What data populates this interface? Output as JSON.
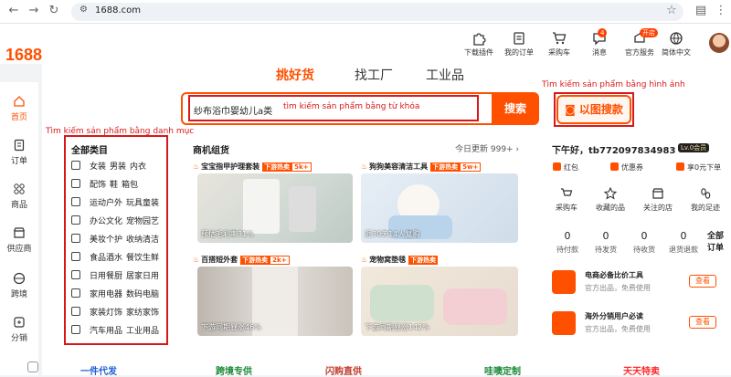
{
  "browser": {
    "url": "1688.com"
  },
  "logo": "1688",
  "topnav": [
    {
      "label": "下载插件"
    },
    {
      "label": "我的订单"
    },
    {
      "label": "采购车"
    },
    {
      "label": "消息",
      "badge": "4"
    },
    {
      "label": "官方服务",
      "badge": "开店"
    },
    {
      "label": "简体中文"
    }
  ],
  "sidebar": [
    {
      "label": "首页"
    },
    {
      "label": "订单"
    },
    {
      "label": "商品"
    },
    {
      "label": "供应商"
    },
    {
      "label": "跨境"
    },
    {
      "label": "分销"
    }
  ],
  "tabs": [
    {
      "label": "挑好货"
    },
    {
      "label": "找工厂"
    },
    {
      "label": "工业品"
    }
  ],
  "search": {
    "value": "纱布浴巾婴幼儿a类",
    "button": "搜索"
  },
  "image_search": {
    "label": "以图搜款"
  },
  "annotations": {
    "keyword": "tìm kiếm sản phẩm bằng từ khóa",
    "image": "Tìm kiếm sản phẩm bằng hình ảnh",
    "category": "Tìm kiếm sản phẩm bằng danh mục"
  },
  "categories": {
    "title": "全部类目",
    "rows": [
      [
        "女装",
        "男装",
        "内衣"
      ],
      [
        "配饰",
        "鞋",
        "箱包"
      ],
      [
        "运动户外",
        "玩具童装"
      ],
      [
        "办公文化",
        "宠物园艺"
      ],
      [
        "美妆个护",
        "收纳清洁"
      ],
      [
        "食品酒水",
        "餐饮生鲜"
      ],
      [
        "日用餐厨",
        "居家日用"
      ],
      [
        "家用电器",
        "数码电脑"
      ],
      [
        "家装灯饰",
        "家纺家饰"
      ],
      [
        "汽车用品",
        "工业用品"
      ]
    ]
  },
  "opportunity": {
    "title": "商机组货",
    "update": "今日更新 999+ ›",
    "hot": "下游热卖",
    "cards": [
      {
        "title": "宝宝指甲护理套装",
        "num": "5k+",
        "caption": "预估毛利率31%"
      },
      {
        "title": "狗狗美容清洁工具",
        "num": "5w+",
        "caption": "近30天14人复购"
      },
      {
        "title": "百搭短外套",
        "num": "2k+",
        "caption": "下游同期暴涨46%"
      },
      {
        "title": "宠物窝垫毯",
        "num": "",
        "caption": "下游同期暴涨142%"
      }
    ]
  },
  "user": {
    "greeting": "下午好，tb772097834983",
    "level": "Lv.0会员",
    "perks": [
      "红包",
      "优惠券",
      "享0元下单"
    ],
    "quick": [
      "采购车",
      "收藏的品",
      "关注的店",
      "我的足迹"
    ],
    "counts": [
      {
        "n": "0",
        "label": "待付款"
      },
      {
        "n": "0",
        "label": "待发货"
      },
      {
        "n": "0",
        "label": "待收货"
      },
      {
        "n": "0",
        "label": "退货退款"
      }
    ],
    "all_orders": "全部订单"
  },
  "tools": [
    {
      "title": "电商必备比价工具",
      "sub": "官方出品，免费使用",
      "btn": "查看"
    },
    {
      "title": "海外分销用户必读",
      "sub": "官方出品，免费使用",
      "btn": "查看"
    }
  ],
  "bottom": [
    "一件代发",
    "跨境专供",
    "闪购直供",
    "哇噢定制",
    "天天特卖"
  ]
}
